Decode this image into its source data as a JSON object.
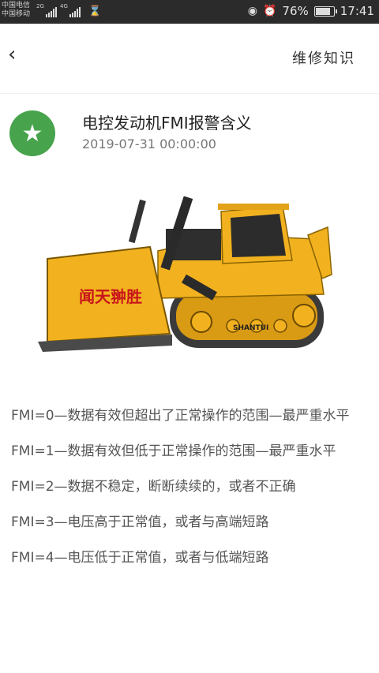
{
  "status_bar": {
    "carrier_1": "中国电信",
    "carrier_2": "中国移动",
    "net_1": "2G",
    "net_2": "4G",
    "battery_percent": "76%",
    "battery_level": 0.76,
    "time": "17:41",
    "icons": [
      "signal-icon",
      "hourglass-icon",
      "eye-icon",
      "alarm-icon",
      "battery-icon"
    ]
  },
  "nav": {
    "back_icon": "chevron-left-icon",
    "title": "维修知识"
  },
  "article": {
    "title": "电控发动机FMI报警含义",
    "date": "2019-07-31 00:00:00",
    "badge_icon": "star-icon",
    "badge_color": "#47a34c",
    "hero_text": "闻天翀胜",
    "hero_brand": "SHANTUI",
    "paragraphs": [
      "FMI=0—数据有效但超出了正常操作的范围—最严重水平",
      "FMI=1—数据有效但低于正常操作的范围—最严重水平",
      "FMI=2—数据不稳定，断断续续的，或者不正确",
      "FMI=3—电压高于正常值，或者与高端短路",
      "FMI=4—电压低于正常值，或者与低端短路"
    ]
  },
  "colors": {
    "statusbar_bg": "#2b2b2b",
    "bulldozer_yellow": "#f2b21f",
    "text": "#555555"
  }
}
